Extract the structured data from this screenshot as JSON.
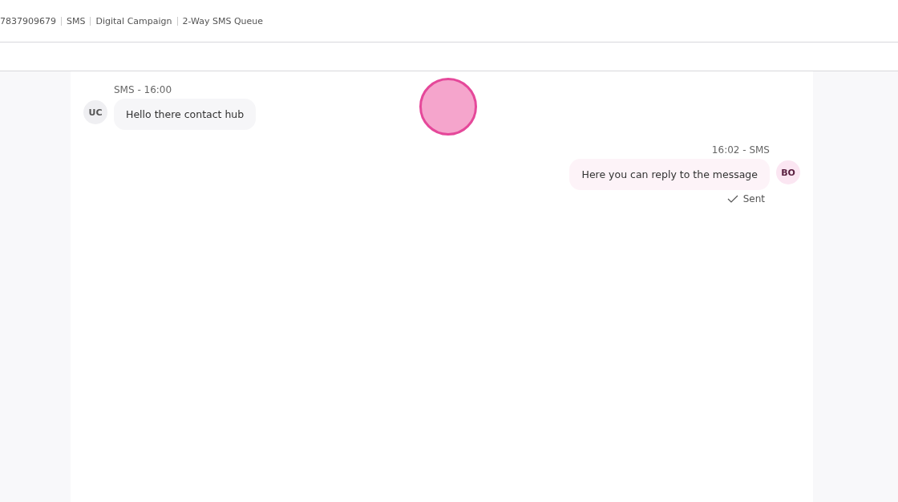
{
  "breadcrumb": [
    "7837909679",
    "SMS",
    "Digital Campaign",
    "2-Way SMS Queue"
  ],
  "messages": [
    {
      "kind": "inbound",
      "avatar": "UC",
      "meta": "SMS - 16:00",
      "text": "Hello there contact hub"
    },
    {
      "kind": "outbound",
      "avatar": "BO",
      "meta": "16:02 - SMS",
      "text": "Here you can reply to the message",
      "status": "Sent"
    }
  ]
}
